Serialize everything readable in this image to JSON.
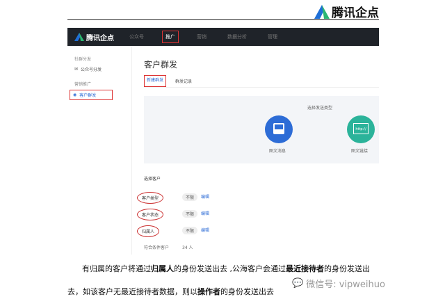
{
  "logo": {
    "text": "腾讯企点"
  },
  "app": {
    "brand": "腾讯企点",
    "nav": [
      "公众号",
      "推广",
      "营销",
      "数据分析",
      "管理"
    ],
    "sidebar": {
      "group1": "社群分发",
      "item1": "公众号分发",
      "group2": "营销推广",
      "item2": "客户群发"
    },
    "page_title": "客户群发",
    "tabs": [
      "新建群发",
      "群发记录"
    ],
    "send_type": {
      "heading": "选择发送类型",
      "options": [
        "图文消息",
        "图文链接"
      ],
      "link_icon_text": "http://"
    },
    "customers": {
      "heading": "选择客户",
      "rows": [
        {
          "label": "客户类型",
          "value": "不限",
          "action": "编辑"
        },
        {
          "label": "客户状态",
          "value": "不限",
          "action": "编辑"
        },
        {
          "label": "归属人",
          "value": "不限",
          "action": "编辑"
        }
      ],
      "match_label": "符合条件客户",
      "match_value": "34 人"
    }
  },
  "paragraph": {
    "p1": "有归属的客户将通过",
    "b1": "归属人",
    "p2": "的身份发送出去 ,公海客户会通过",
    "b2": "最近接待者",
    "p3": "的身份发送出",
    "p4": "去，如该客户无最近接待者数据，则以",
    "b3": "操作者",
    "p5": "的身份发送出去"
  },
  "watermark": "微信号: vipweihuo"
}
